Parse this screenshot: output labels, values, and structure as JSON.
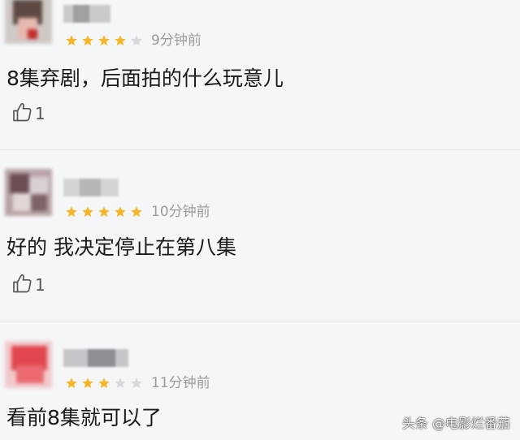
{
  "colors": {
    "star_filled": "#f6b62a",
    "star_empty": "#d9d9dc",
    "background": "#f5f6f8",
    "divider": "#e3e4e7"
  },
  "comments": [
    {
      "rating": 4,
      "time": "9分钟前",
      "text": "8集弃剧，后面拍的什么玩意儿",
      "likes": "1",
      "like_icon": "thumbs-up-icon"
    },
    {
      "rating": 5,
      "time": "10分钟前",
      "text": "好的 我决定停止在第八集",
      "likes": "1",
      "like_icon": "thumbs-up-icon"
    },
    {
      "rating": 3,
      "time": "11分钟前",
      "text": "看前8集就可以了"
    }
  ],
  "watermark": "头条 @电影烂番茄"
}
